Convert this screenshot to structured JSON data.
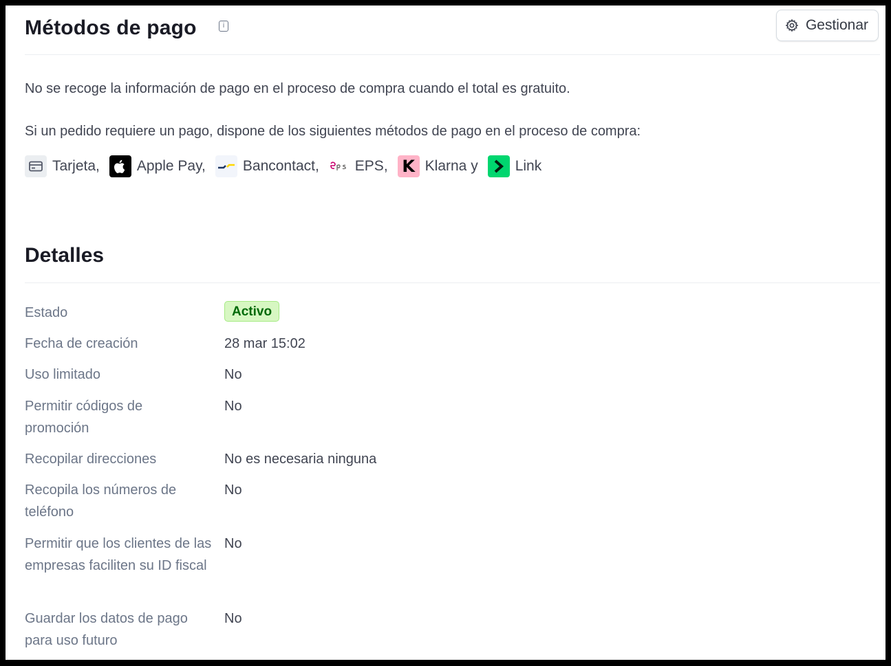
{
  "header": {
    "title": "Métodos de pago",
    "info_glyph": "i",
    "manage_label": "Gestionar"
  },
  "intro": {
    "line1": "No se recoge la información de pago en el proceso de compra cuando el total es gratuito.",
    "line2": "Si un pedido requiere un pago, dispone de los siguientes métodos de pago en el proceso de compra:"
  },
  "payment_methods": [
    {
      "label": "Tarjeta,",
      "icon": "card-icon"
    },
    {
      "label": "Apple Pay,",
      "icon": "apple-icon"
    },
    {
      "label": "Bancontact,",
      "icon": "bancontact-icon"
    },
    {
      "label": "EPS,",
      "icon": "eps-icon"
    },
    {
      "label": "Klarna y",
      "icon": "klarna-icon",
      "glyph": "K"
    },
    {
      "label": "Link",
      "icon": "link-icon"
    }
  ],
  "details": {
    "title": "Detalles",
    "rows": [
      {
        "label": "Estado",
        "value": "Activo"
      },
      {
        "label": "Fecha de creación",
        "value": "28 mar 15:02"
      },
      {
        "label": "Uso limitado",
        "value": "No"
      },
      {
        "label": "Permitir códigos de promoción",
        "value": "No"
      },
      {
        "label": "Recopilar direcciones",
        "value": "No es necesaria ninguna"
      },
      {
        "label": "Recopila los números de teléfono",
        "value": "No"
      },
      {
        "label": "Permitir que los clientes de las empresas faciliten su ID fiscal",
        "value": "No"
      },
      {
        "label": "Guardar los datos de pago para uso futuro",
        "value": "No"
      }
    ]
  },
  "colors": {
    "status_badge_bg": "#d7f7c2",
    "status_badge_text": "#006908",
    "klarna": "#ffb3c7",
    "link": "#00d66f"
  }
}
